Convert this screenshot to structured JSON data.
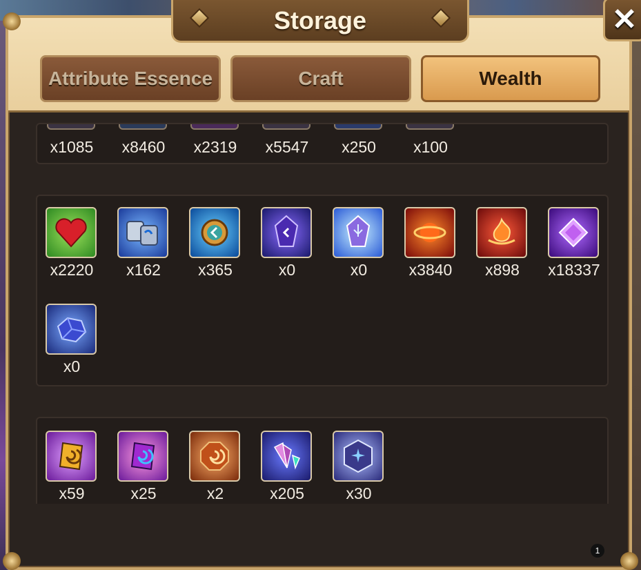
{
  "window": {
    "title": "Storage",
    "close_label": "✕"
  },
  "tabs": [
    {
      "label": "Attribute Essence",
      "active": false
    },
    {
      "label": "Craft",
      "active": false
    },
    {
      "label": "Wealth",
      "active": true
    }
  ],
  "sections": [
    {
      "name": "top-partial",
      "items": [
        {
          "count": "x1085"
        },
        {
          "count": "x8460"
        },
        {
          "count": "x2319"
        },
        {
          "count": "x5547"
        },
        {
          "count": "x250"
        },
        {
          "count": "x100"
        }
      ]
    },
    {
      "name": "middle",
      "items": [
        {
          "icon": "heart-icon",
          "count": "x2220",
          "color": "#3aa43a"
        },
        {
          "icon": "stones-icon",
          "count": "x162",
          "color": "#2a6ad6"
        },
        {
          "icon": "coin-rune-icon",
          "count": "x365",
          "color": "#1a8ad6"
        },
        {
          "icon": "purple-crystal-icon",
          "count": "x0",
          "color": "#4a2ab0"
        },
        {
          "icon": "light-crystal-icon",
          "count": "x0",
          "color": "#3a6ad6"
        },
        {
          "icon": "fire-orb-icon",
          "count": "x3840",
          "color": "#b02a1a"
        },
        {
          "icon": "fire-sigil-icon",
          "count": "x898",
          "color": "#c0281a"
        },
        {
          "icon": "pink-diamond-icon",
          "count": "x18337",
          "color": "#7a2ab8"
        },
        {
          "icon": "blue-ore-icon",
          "count": "x0",
          "color": "#2a4ab0"
        }
      ]
    },
    {
      "name": "bottom",
      "items": [
        {
          "icon": "gold-spiral-stone-icon",
          "count": "x59",
          "color": "#c08a1a"
        },
        {
          "icon": "purple-spiral-stone-icon",
          "count": "x25",
          "color": "#8a2ab8"
        },
        {
          "icon": "orange-spiral-stone-icon",
          "count": "x2",
          "color": "#c0501a"
        },
        {
          "icon": "crystal-shards-icon",
          "count": "x205",
          "color": "#4a4ab8"
        },
        {
          "icon": "hex-star-gem-icon",
          "count": "x30",
          "color": "#3a4a9a"
        }
      ]
    }
  ],
  "page_indicator": "1"
}
